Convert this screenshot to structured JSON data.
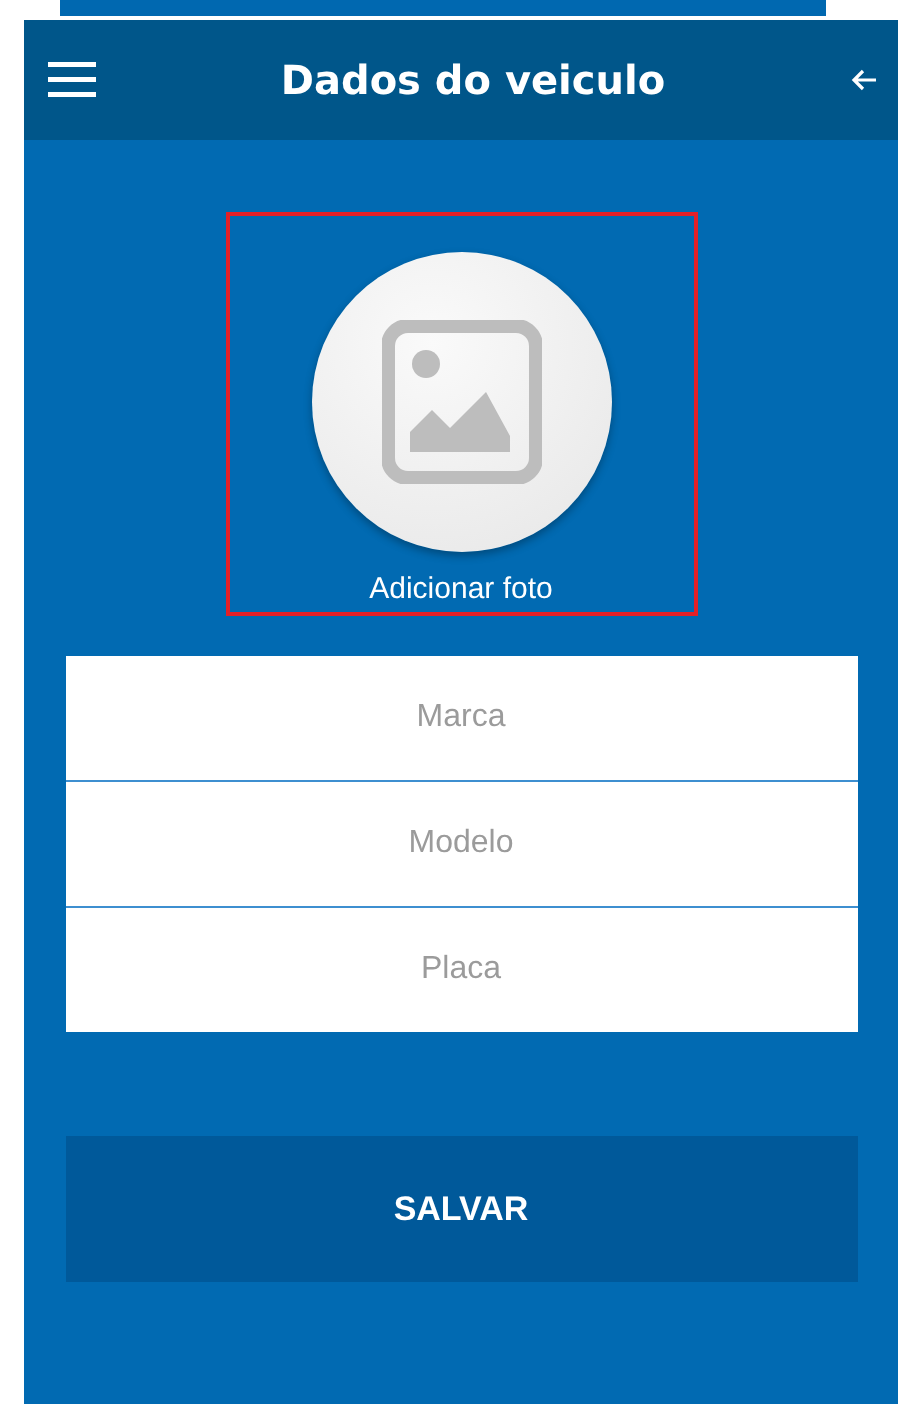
{
  "header": {
    "title": "Dados do veiculo"
  },
  "photo": {
    "label": "Adicionar foto",
    "highlighted": true
  },
  "fields": [
    {
      "placeholder": "Marca"
    },
    {
      "placeholder": "Modelo"
    },
    {
      "placeholder": "Placa"
    }
  ],
  "save_button": {
    "label": "SALVAR"
  }
}
